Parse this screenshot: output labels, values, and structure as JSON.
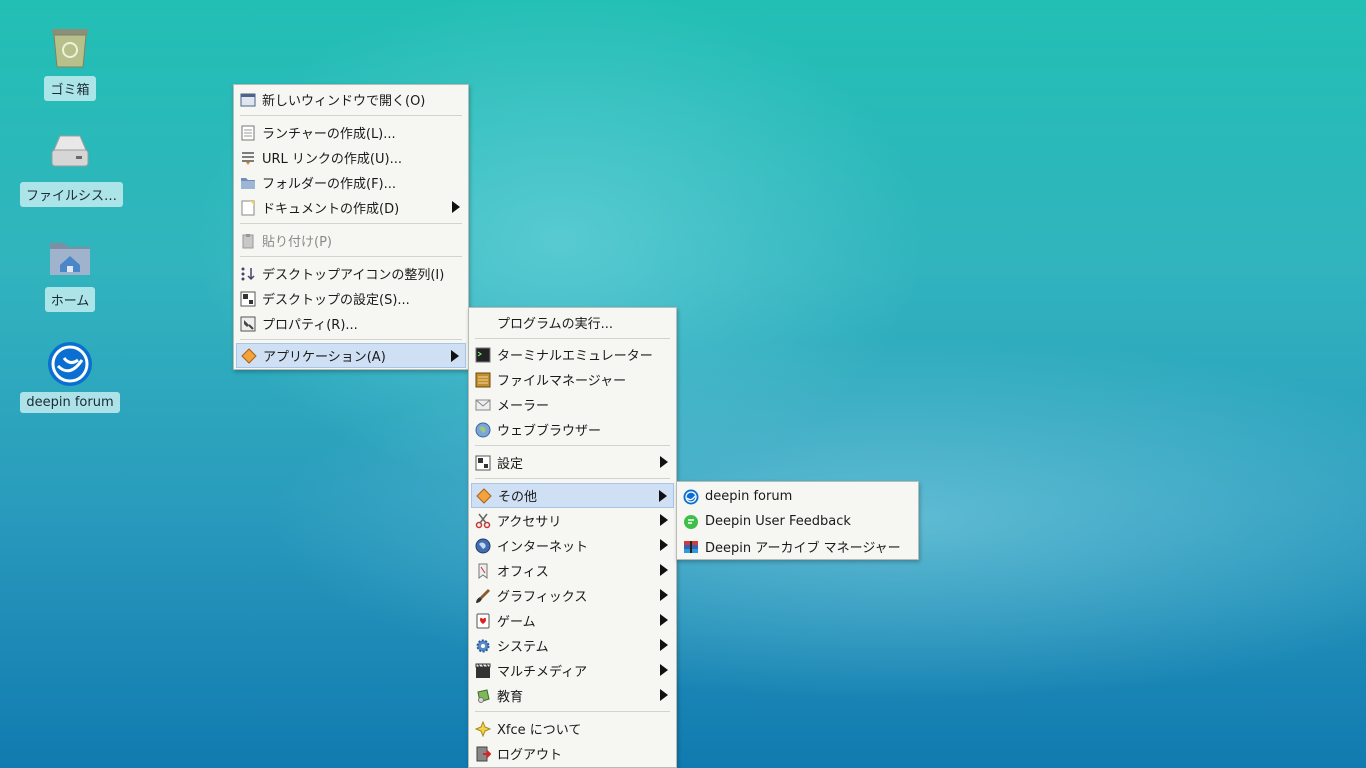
{
  "desktop": {
    "icons": [
      {
        "label": "ゴミ箱",
        "icon": "trash-icon"
      },
      {
        "label": "ファイルシス…",
        "icon": "drive-icon"
      },
      {
        "label": "ホーム",
        "icon": "home-folder-icon"
      },
      {
        "label": "deepin forum",
        "icon": "deepin-logo-icon"
      }
    ]
  },
  "context_menu": {
    "items": [
      {
        "label": "新しいウィンドウで開く(O)",
        "icon": "open-window-icon"
      },
      {
        "label": "ランチャーの作成(L)...",
        "icon": "launcher-icon"
      },
      {
        "label": "URL リンクの作成(U)...",
        "icon": "url-link-icon"
      },
      {
        "label": "フォルダーの作成(F)...",
        "icon": "folder-icon"
      },
      {
        "label": "ドキュメントの作成(D)",
        "icon": "document-icon"
      },
      {
        "label": "貼り付け(P)",
        "icon": "paste-icon"
      },
      {
        "label": "デスクトップアイコンの整列(I)",
        "icon": "arrange-icon"
      },
      {
        "label": "デスクトップの設定(S)...",
        "icon": "desktop-settings-icon"
      },
      {
        "label": "プロパティ(R)...",
        "icon": "properties-icon"
      },
      {
        "label": "アプリケーション(A)",
        "icon": "applications-icon"
      }
    ]
  },
  "apps_menu": {
    "items": [
      {
        "label": "プログラムの実行..."
      },
      {
        "label": "ターミナルエミュレーター",
        "icon": "terminal-icon"
      },
      {
        "label": "ファイルマネージャー",
        "icon": "file-manager-icon"
      },
      {
        "label": "メーラー",
        "icon": "mail-icon"
      },
      {
        "label": "ウェブブラウザー",
        "icon": "web-browser-icon"
      },
      {
        "label": "設定",
        "icon": "settings-icon"
      },
      {
        "label": "その他",
        "icon": "other-icon"
      },
      {
        "label": "アクセサリ",
        "icon": "accessories-icon"
      },
      {
        "label": "インターネット",
        "icon": "internet-icon"
      },
      {
        "label": "オフィス",
        "icon": "office-icon"
      },
      {
        "label": "グラフィックス",
        "icon": "graphics-icon"
      },
      {
        "label": "ゲーム",
        "icon": "games-icon"
      },
      {
        "label": "システム",
        "icon": "system-icon"
      },
      {
        "label": "マルチメディア",
        "icon": "multimedia-icon"
      },
      {
        "label": "教育",
        "icon": "education-icon"
      },
      {
        "label": "Xfce について",
        "icon": "about-xfce-icon"
      },
      {
        "label": "ログアウト",
        "icon": "logout-icon"
      }
    ]
  },
  "other_menu": {
    "items": [
      {
        "label": "deepin forum",
        "icon": "deepin-logo-icon"
      },
      {
        "label": "Deepin User Feedback",
        "icon": "feedback-icon"
      },
      {
        "label": "Deepin アーカイブ マネージャー",
        "icon": "archive-manager-icon"
      }
    ]
  },
  "colors": {
    "selection": "#cfe0f4",
    "menu_bg": "#f6f6f2",
    "desktop_top": "#22bfb4",
    "desktop_bottom": "#117ab0"
  }
}
